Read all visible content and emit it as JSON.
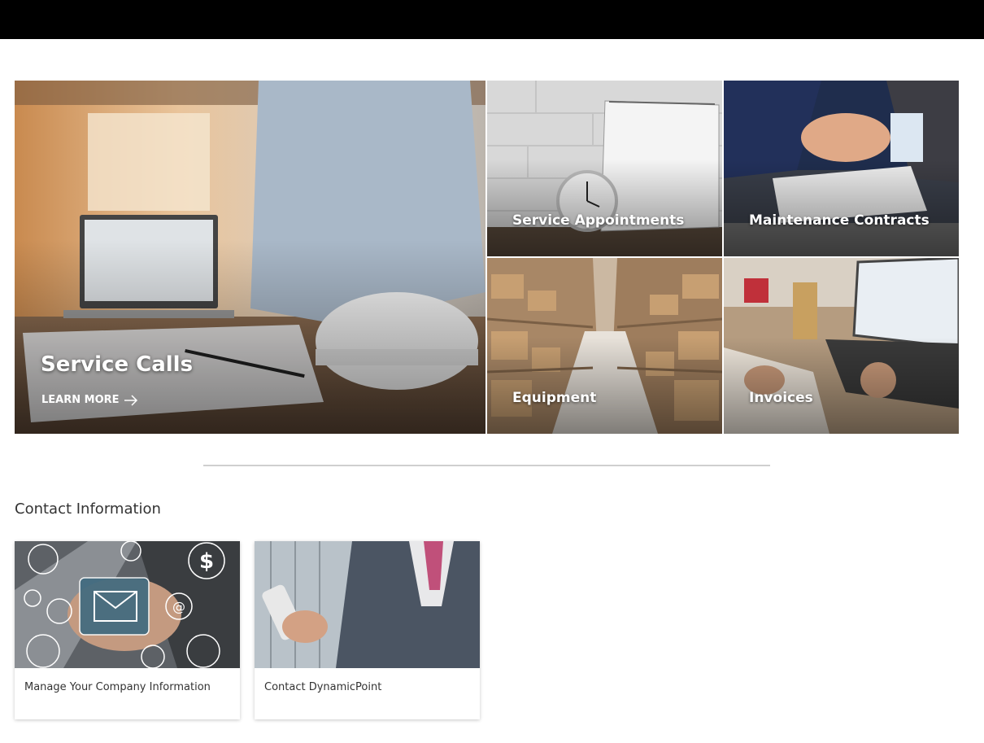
{
  "header": {
    "color": "#000000"
  },
  "hero": {
    "main_tile": {
      "title": "Service Calls",
      "cta": "LEARN MORE"
    },
    "tiles": [
      {
        "label": "Service Appointments"
      },
      {
        "label": "Maintenance Contracts"
      },
      {
        "label": "Equipment"
      },
      {
        "label": "Invoices"
      }
    ]
  },
  "contact": {
    "title": "Contact Information",
    "cards": [
      {
        "label": "Manage Your Company Information"
      },
      {
        "label": "Contact DynamicPoint"
      }
    ]
  }
}
